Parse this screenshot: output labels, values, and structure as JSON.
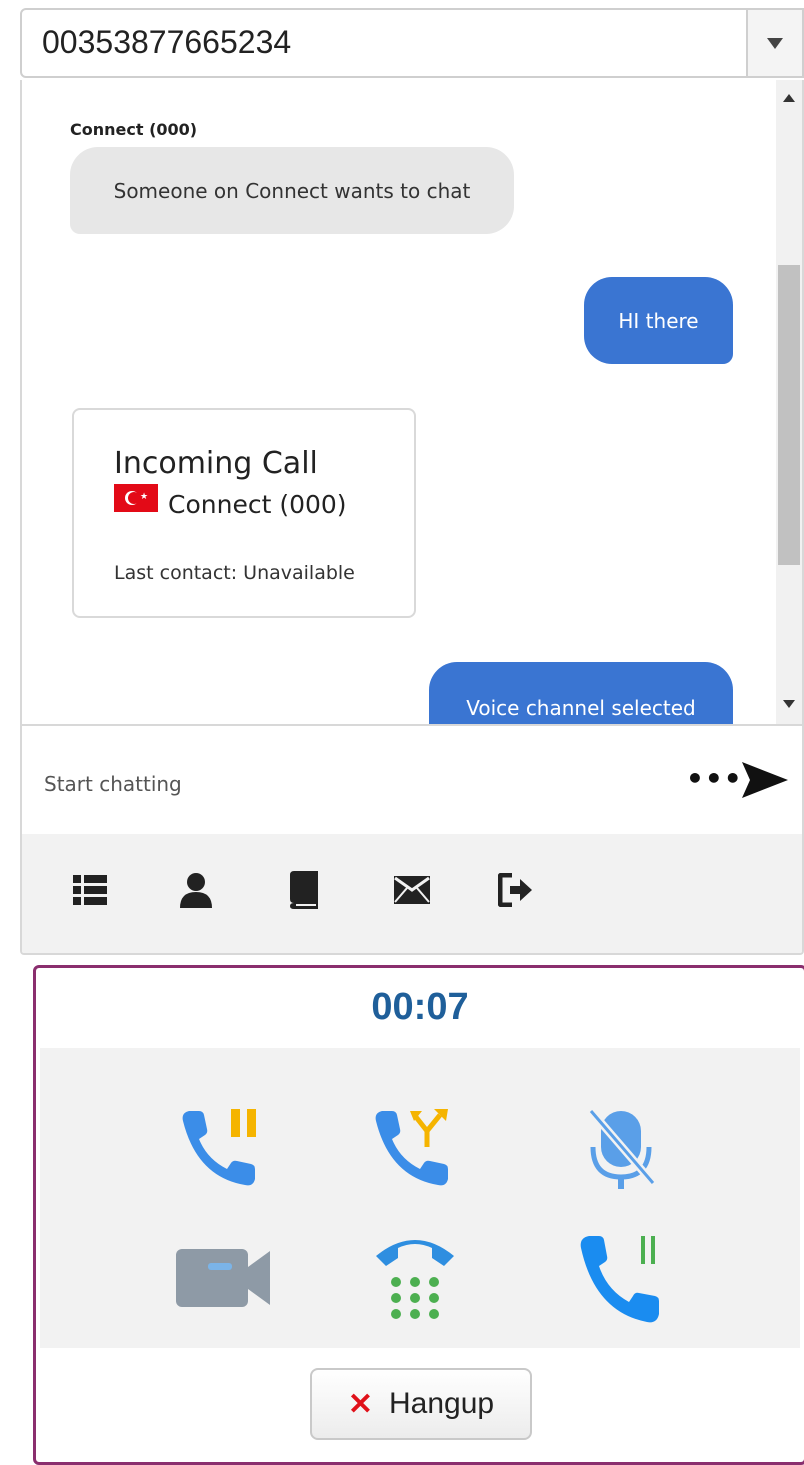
{
  "number_select": {
    "value": "00353877665234"
  },
  "chat": {
    "messages": {
      "incoming": {
        "sender": "Connect (000)",
        "text": "Someone on Connect wants to chat"
      },
      "outgoing_1": {
        "text": "HI there"
      },
      "call_card": {
        "title": "Incoming Call",
        "caller": "Connect (000)",
        "flag_icon": "turkey-flag-icon",
        "last_contact": "Last contact: Unavailable"
      },
      "outgoing_2": {
        "text": "Voice channel selected"
      }
    },
    "composer": {
      "placeholder": "Start chatting"
    },
    "toolbar": {
      "icons": [
        "list-icon",
        "contact-icon",
        "book-icon",
        "envelope-icon",
        "logout-icon"
      ]
    }
  },
  "call": {
    "timer": "00:07",
    "controls": [
      "hold-call-icon",
      "transfer-call-icon",
      "mute-microphone-icon",
      "video-camera-icon",
      "dialpad-icon",
      "resume-call-icon"
    ],
    "hangup_label": "Hangup"
  },
  "colors": {
    "outgoing_bubble": "#3a75d2",
    "incoming_bubble": "#e7e7e7",
    "timer": "#1f5f9a",
    "call_panel_border": "#8a2e6e",
    "hangup_x": "#e0111a"
  }
}
